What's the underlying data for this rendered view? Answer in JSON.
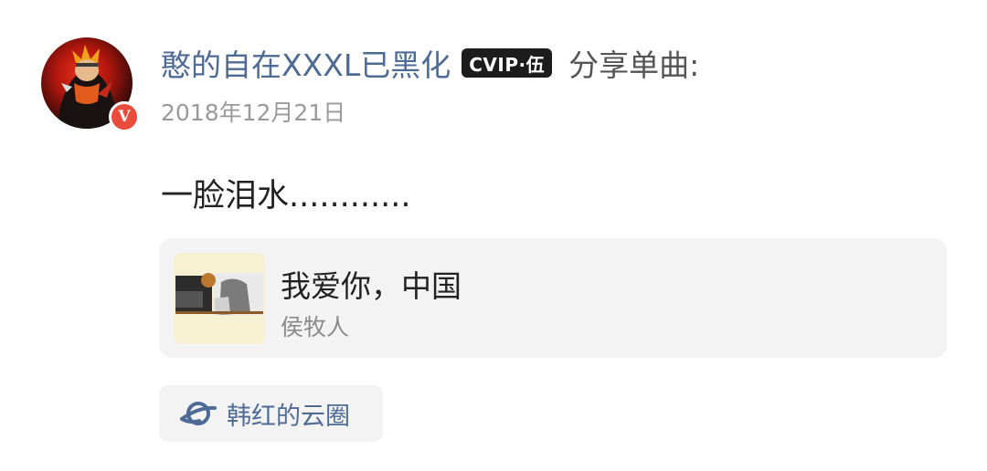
{
  "post": {
    "user": {
      "name": "憨的自在XXXL已黑化",
      "vip_badge": "CVIP·伍",
      "verified_mark": "V",
      "avatar_icon": "avatar-anime-character",
      "accent_color": "#4e6b95"
    },
    "action": "分享单曲:",
    "date": "2018年12月21日",
    "content": "一脸泪水............",
    "song": {
      "title": "我爱你，中国",
      "artist": "侯牧人",
      "cover_icon": "album-cover"
    },
    "circle": {
      "icon": "planet-icon",
      "label": "韩红的云圈"
    }
  }
}
